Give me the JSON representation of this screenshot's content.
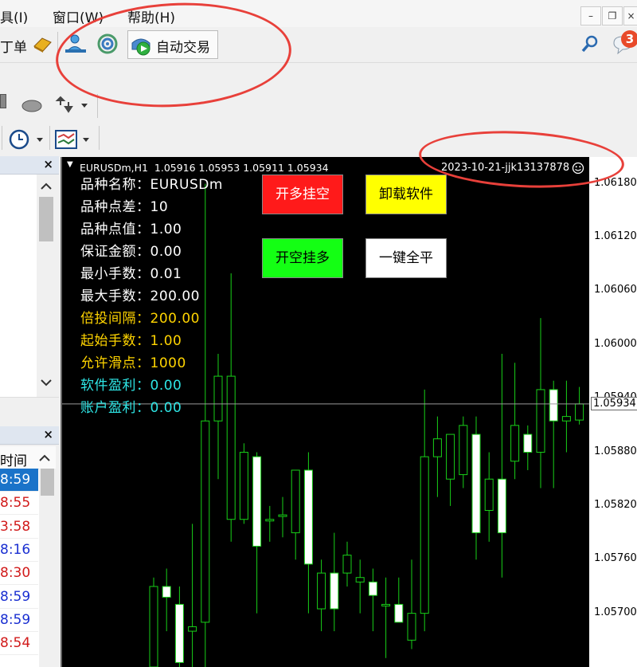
{
  "menu": {
    "tools": "具(I)",
    "window": "窗口(W)",
    "help": "帮助(H)"
  },
  "window_controls": {
    "minimize": "–",
    "restore": "❐",
    "close": "×"
  },
  "toolbar": {
    "order_label": "丁单",
    "autotrade_label": "自动交易",
    "notifications_count": "3"
  },
  "left_panel": {
    "close_label": "×",
    "time_header": "时间",
    "times": [
      {
        "text": "8:59",
        "color": "#ffffff",
        "bg": "#1a73c9"
      },
      {
        "text": "8:55",
        "color": "#d11a1a",
        "bg": "#ffffff"
      },
      {
        "text": "3:58",
        "color": "#d11a1a",
        "bg": "#ffffff"
      },
      {
        "text": "8:16",
        "color": "#1a2fd1",
        "bg": "#ffffff"
      },
      {
        "text": "8:30",
        "color": "#d11a1a",
        "bg": "#ffffff"
      },
      {
        "text": "8:59",
        "color": "#1a2fd1",
        "bg": "#ffffff"
      },
      {
        "text": "8:59",
        "color": "#1a2fd1",
        "bg": "#ffffff"
      },
      {
        "text": "8:54",
        "color": "#d11a1a",
        "bg": "#ffffff"
      }
    ]
  },
  "chart": {
    "header": "EURUSDm,H1  1.05916 1.05953 1.05911 1.05934",
    "stamp": "2023-10-21-jjk13137878",
    "current_price": "1.05934",
    "info_lines": [
      {
        "text": "品种名称：EURUSDm",
        "color": "#ffffff"
      },
      {
        "text": "品种点差：10",
        "color": "#ffffff"
      },
      {
        "text": "品种点值：1.00",
        "color": "#ffffff"
      },
      {
        "text": "保证金额：0.00",
        "color": "#ffffff"
      },
      {
        "text": "最小手数：0.01",
        "color": "#ffffff"
      },
      {
        "text": "最大手数：200.00",
        "color": "#ffffff"
      },
      {
        "text": "倍投间隔：200.00",
        "color": "#ffd400"
      },
      {
        "text": "起始手数：1.00",
        "color": "#ffd400"
      },
      {
        "text": "允许滑点：1000",
        "color": "#ffd400"
      },
      {
        "text": "软件盈利：0.00",
        "color": "#2ee6e6"
      },
      {
        "text": "账户盈利：0.00",
        "color": "#2ee6e6"
      }
    ],
    "buttons": {
      "buy_label": "开多挂空",
      "uninstall_label": "卸载软件",
      "sell_label": "开空挂多",
      "close_all_label": "一键全平"
    }
  },
  "chart_data": {
    "type": "candlestick",
    "y_ticks": [
      "1.06180",
      "1.06120",
      "1.06060",
      "1.06000",
      "1.05940",
      "1.05880",
      "1.05820",
      "1.05760",
      "1.05700"
    ],
    "ylim": [
      1.0564,
      1.0621
    ],
    "current": 1.05934,
    "candles": [
      {
        "o": 1.0564,
        "h": 1.0574,
        "l": 1.0562,
        "c": 1.0573
      },
      {
        "o": 1.0573,
        "h": 1.0575,
        "l": 1.0568,
        "c": 1.05718
      },
      {
        "o": 1.0571,
        "h": 1.0573,
        "l": 1.0564,
        "c": 1.05645
      },
      {
        "o": 1.0568,
        "h": 1.058,
        "l": 1.0563,
        "c": 1.05685
      },
      {
        "o": 1.0569,
        "h": 1.0618,
        "l": 1.0562,
        "c": 1.05915
      },
      {
        "o": 1.05915,
        "h": 1.0599,
        "l": 1.0585,
        "c": 1.05965
      },
      {
        "o": 1.05805,
        "h": 1.0608,
        "l": 1.0578,
        "c": 1.05965
      },
      {
        "o": 1.05805,
        "h": 1.0589,
        "l": 1.058,
        "c": 1.0588
      },
      {
        "o": 1.05875,
        "h": 1.0588,
        "l": 1.057,
        "c": 1.05775
      },
      {
        "o": 1.05805,
        "h": 1.0582,
        "l": 1.0578,
        "c": 1.05805
      },
      {
        "o": 1.0581,
        "h": 1.0583,
        "l": 1.05785,
        "c": 1.0581
      },
      {
        "o": 1.0579,
        "h": 1.0586,
        "l": 1.0576,
        "c": 1.0586
      },
      {
        "o": 1.0586,
        "h": 1.0588,
        "l": 1.057,
        "c": 1.05755
      },
      {
        "o": 1.05705,
        "h": 1.0576,
        "l": 1.0568,
        "c": 1.05745
      },
      {
        "o": 1.05745,
        "h": 1.0579,
        "l": 1.0568,
        "c": 1.05705
      },
      {
        "o": 1.05745,
        "h": 1.0578,
        "l": 1.0573,
        "c": 1.05765
      },
      {
        "o": 1.05735,
        "h": 1.0576,
        "l": 1.057,
        "c": 1.0574
      },
      {
        "o": 1.05735,
        "h": 1.0575,
        "l": 1.0568,
        "c": 1.0572
      },
      {
        "o": 1.0571,
        "h": 1.0574,
        "l": 1.0565,
        "c": 1.0571
      },
      {
        "o": 1.0571,
        "h": 1.0574,
        "l": 1.0569,
        "c": 1.0569
      },
      {
        "o": 1.0567,
        "h": 1.0576,
        "l": 1.0566,
        "c": 1.057
      },
      {
        "o": 1.057,
        "h": 1.0595,
        "l": 1.0568,
        "c": 1.05875
      },
      {
        "o": 1.05875,
        "h": 1.0592,
        "l": 1.0583,
        "c": 1.05895
      },
      {
        "o": 1.0585,
        "h": 1.059,
        "l": 1.0582,
        "c": 1.059
      },
      {
        "o": 1.05855,
        "h": 1.0592,
        "l": 1.0584,
        "c": 1.0591
      },
      {
        "o": 1.059,
        "h": 1.0592,
        "l": 1.0576,
        "c": 1.0579
      },
      {
        "o": 1.05815,
        "h": 1.0588,
        "l": 1.0578,
        "c": 1.0585
      },
      {
        "o": 1.0585,
        "h": 1.0599,
        "l": 1.0574,
        "c": 1.0579
      },
      {
        "o": 1.0587,
        "h": 1.0598,
        "l": 1.0585,
        "c": 1.0591
      },
      {
        "o": 1.059,
        "h": 1.0591,
        "l": 1.0586,
        "c": 1.0588
      },
      {
        "o": 1.0588,
        "h": 1.0603,
        "l": 1.0584,
        "c": 1.0595
      },
      {
        "o": 1.0595,
        "h": 1.0596,
        "l": 1.0584,
        "c": 1.05915
      },
      {
        "o": 1.05915,
        "h": 1.0596,
        "l": 1.0588,
        "c": 1.0592
      },
      {
        "o": 1.05916,
        "h": 1.05953,
        "l": 1.05911,
        "c": 1.05934
      }
    ]
  }
}
